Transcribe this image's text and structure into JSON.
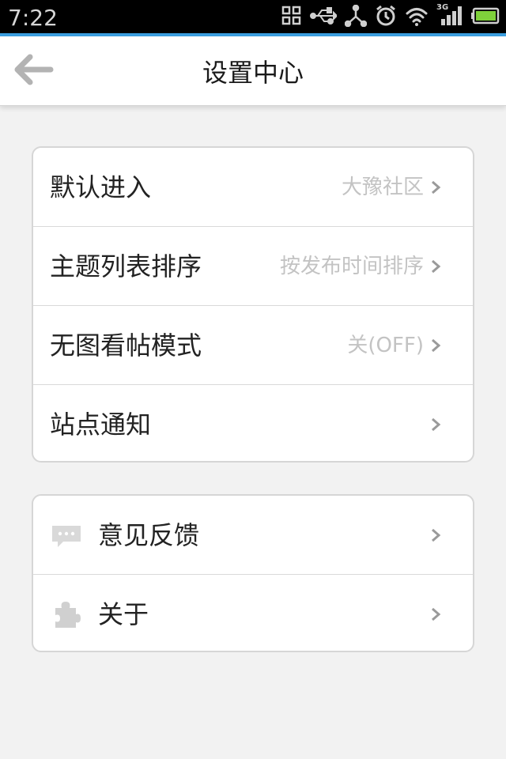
{
  "status_bar": {
    "time": "7:22",
    "icons": [
      "apps-grid-icon",
      "usb-icon",
      "share-icon",
      "alarm-icon",
      "wifi-icon",
      "signal-3g-icon",
      "battery-icon"
    ],
    "network_label": "3G",
    "accent_color": "#3b9fe0"
  },
  "header": {
    "title": "设置中心",
    "back_icon": "back-arrow-icon"
  },
  "settings_group": {
    "items": [
      {
        "label": "默认进入",
        "value": "大豫社区"
      },
      {
        "label": "主题列表排序",
        "value": "按发布时间排序"
      },
      {
        "label": "无图看帖模式",
        "value": "关(OFF)"
      },
      {
        "label": "站点通知",
        "value": ""
      }
    ]
  },
  "more_group": {
    "items": [
      {
        "label": "意见反馈",
        "icon": "chat-bubble-icon"
      },
      {
        "label": "关于",
        "icon": "puzzle-icon"
      }
    ]
  }
}
